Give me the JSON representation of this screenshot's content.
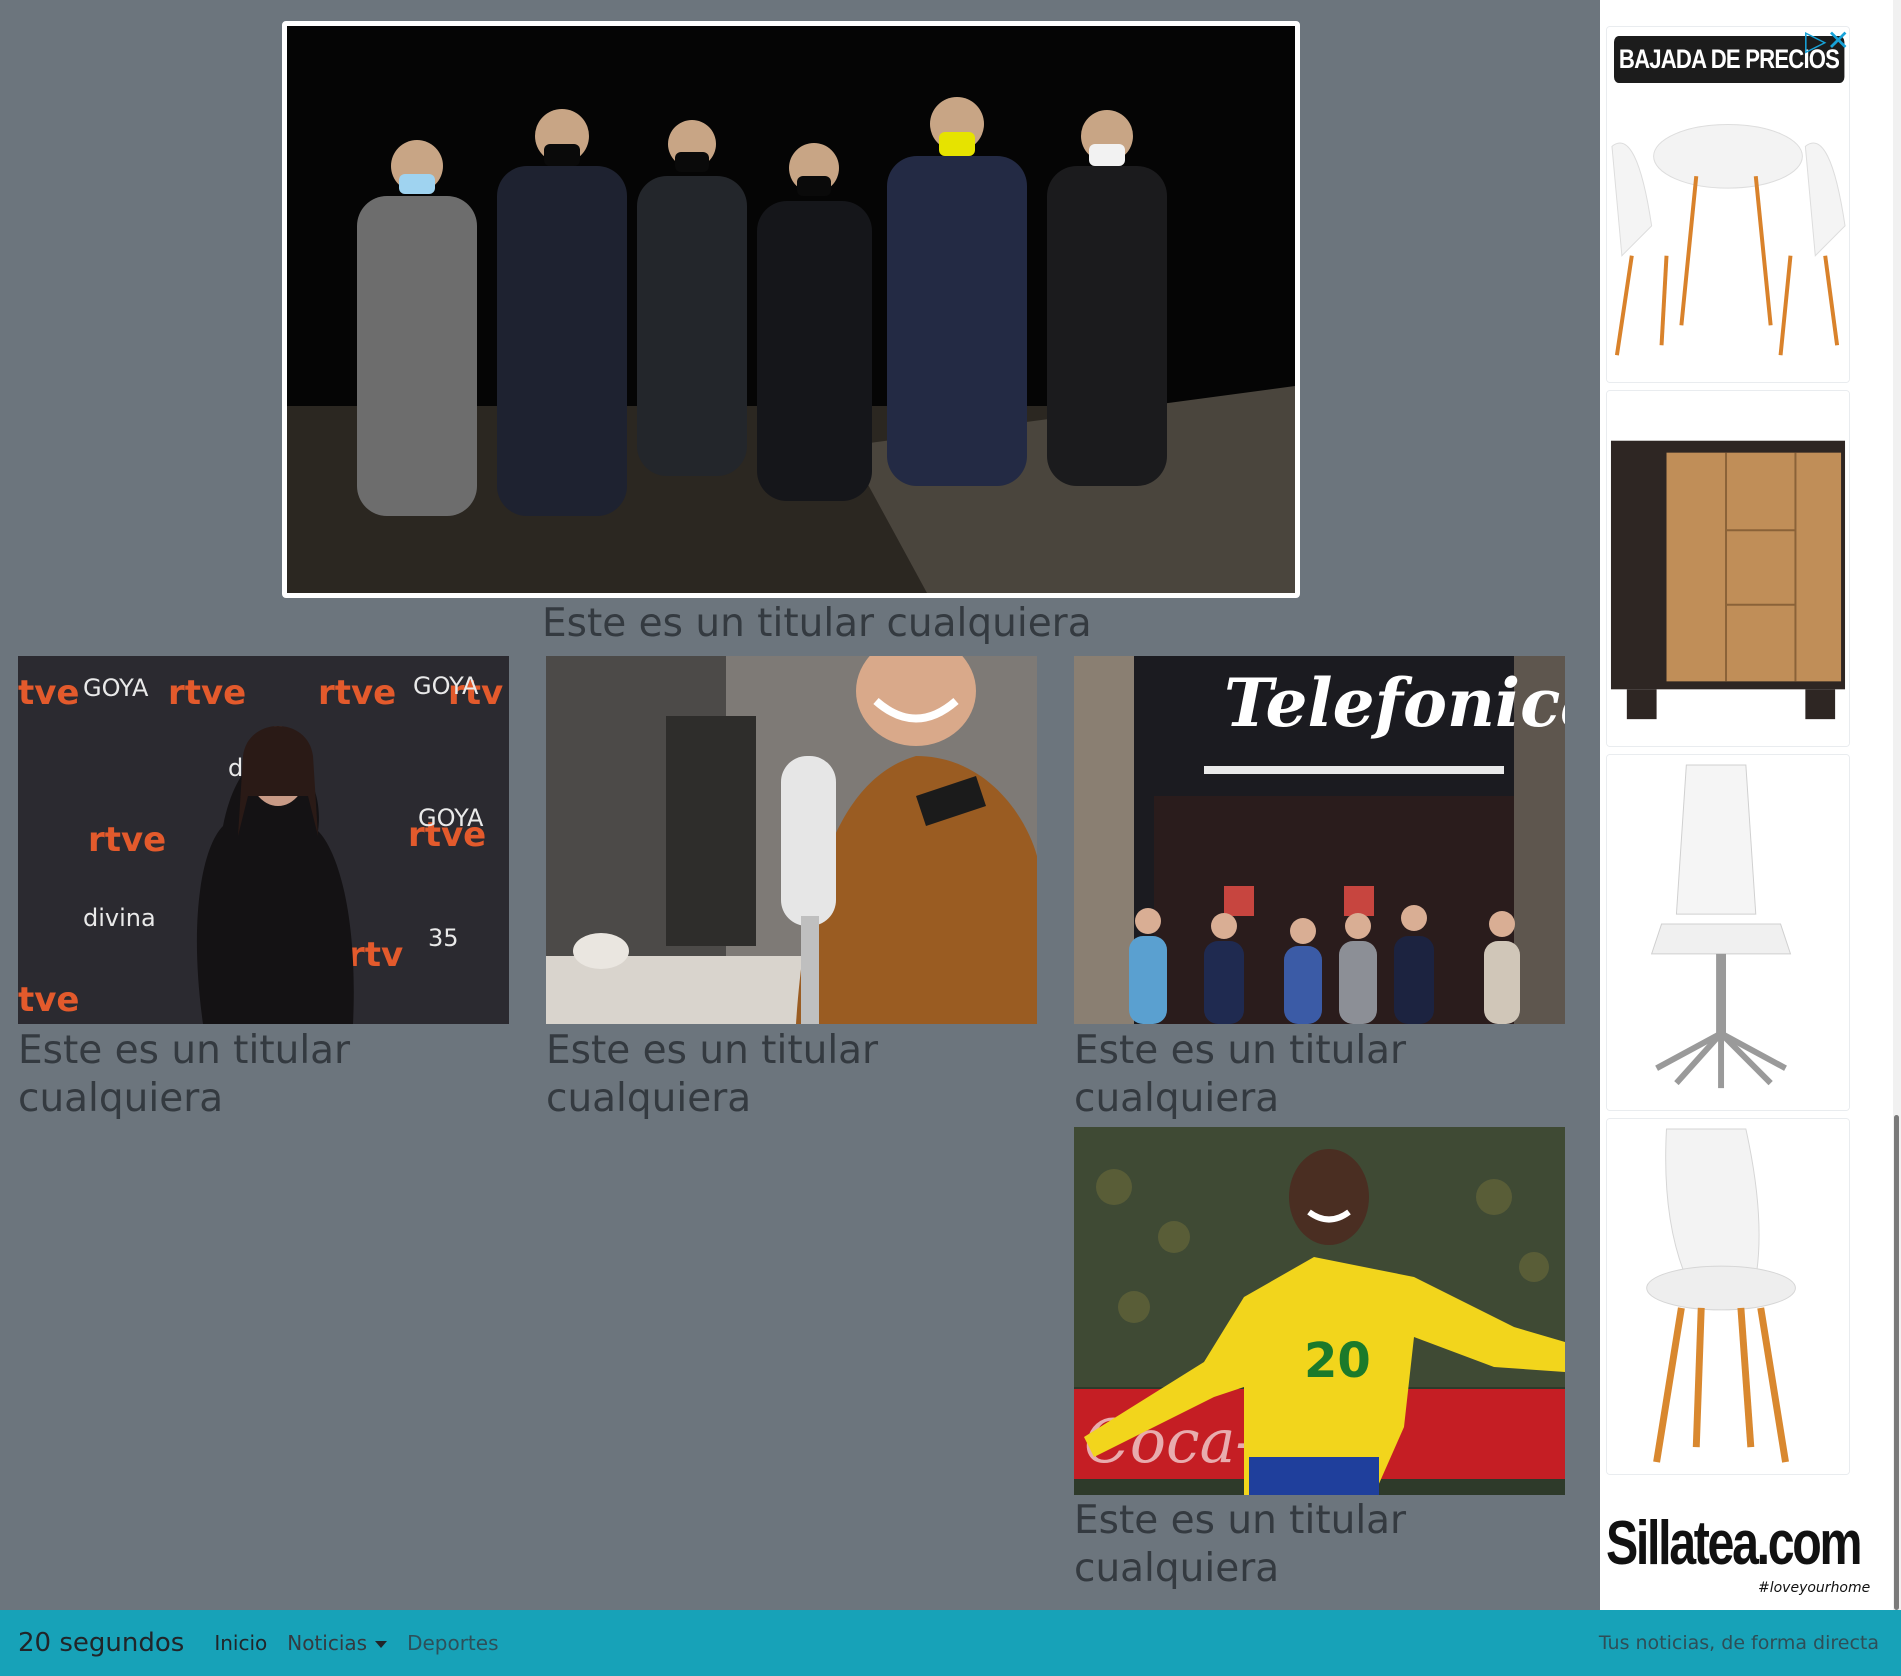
{
  "featured": {
    "headline": "Este es un titular cualquiera",
    "image": "group-of-people-walking-at-night-photo"
  },
  "cards": [
    {
      "headline": "Este es un titular cualquiera",
      "image": "woman-at-goya-35-red-carpet-photo"
    },
    {
      "headline": "Este es un titular cualquiera",
      "image": "woman-with-podcast-microphone-photo"
    },
    {
      "headline": "Este es un titular cualquiera",
      "image": "telefonica-building-photo"
    },
    {
      "headline": "Este es un titular cualquiera",
      "image": "brazil-football-player-celebrating-photo"
    }
  ],
  "ad": {
    "banner": "BAJADA DE PRECIOS",
    "brand": "Sillatea.com",
    "tagline": "#loveyourhome",
    "products": [
      "round-table-with-chairs",
      "wooden-sideboard",
      "white-office-chair",
      "white-dining-chair"
    ]
  },
  "navbar": {
    "brand": "20 segundos",
    "links": [
      "Inicio",
      "Noticias",
      "Deportes"
    ],
    "tagline": "Tus noticias, de forma directa"
  },
  "colors": {
    "background": "#6c757d",
    "navbar": "#17a2b8",
    "text": "#343a40"
  }
}
